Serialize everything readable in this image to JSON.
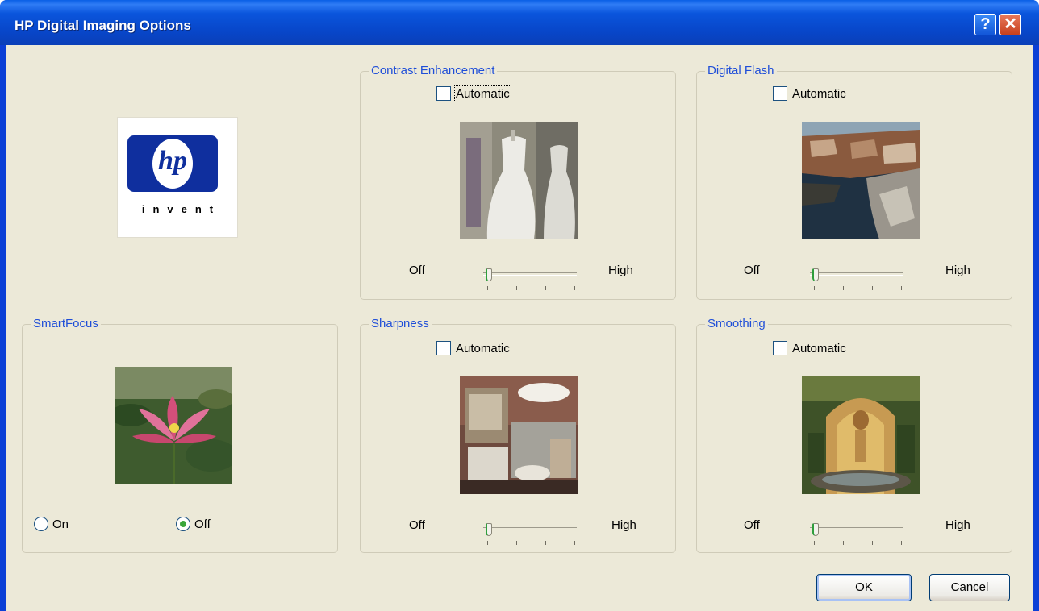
{
  "window": {
    "title": "HP Digital Imaging Options",
    "help_glyph": "?",
    "close_glyph": "✕"
  },
  "logo": {
    "mark": "hp",
    "tagline": "invent"
  },
  "contrast": {
    "legend": "Contrast Enhancement",
    "automatic_label": "Automatic",
    "automatic_checked": false,
    "off_label": "Off",
    "high_label": "High",
    "level": 0
  },
  "digital_flash": {
    "legend": "Digital Flash",
    "automatic_label": "Automatic",
    "automatic_checked": false,
    "off_label": "Off",
    "high_label": "High",
    "level": 0
  },
  "smartfocus": {
    "legend": "SmartFocus",
    "on_label": "On",
    "off_label": "Off",
    "selected": "Off"
  },
  "sharpness": {
    "legend": "Sharpness",
    "automatic_label": "Automatic",
    "automatic_checked": false,
    "off_label": "Off",
    "high_label": "High",
    "level": 0
  },
  "smoothing": {
    "legend": "Smoothing",
    "automatic_label": "Automatic",
    "automatic_checked": false,
    "off_label": "Off",
    "high_label": "High",
    "level": 0
  },
  "buttons": {
    "ok": "OK",
    "cancel": "Cancel"
  },
  "colors": {
    "titlebar": "#0a55dc",
    "dialog_bg": "#ece9d8",
    "legend_text": "#1f4ed8"
  }
}
